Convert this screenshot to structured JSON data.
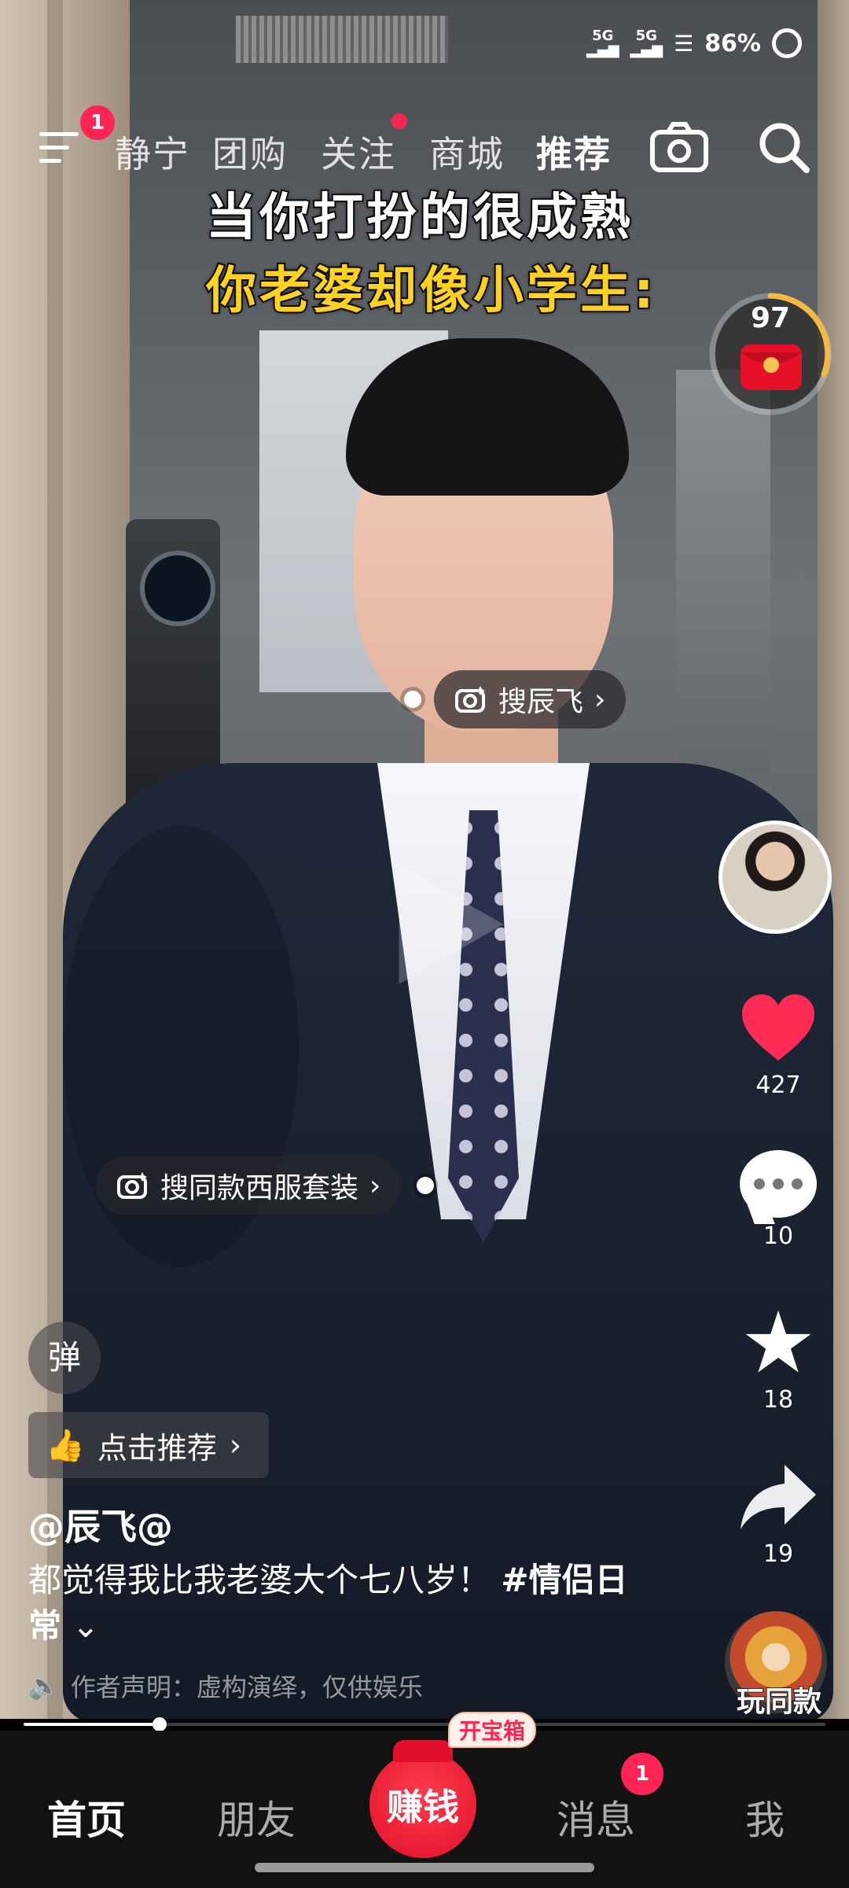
{
  "status_bar": {
    "signal_1": "5G",
    "signal_2": "5G",
    "battery": "86%"
  },
  "top_nav": {
    "menu_badge": "1",
    "tabs": [
      {
        "label": "静宁"
      },
      {
        "label": "团购"
      },
      {
        "label": "关注"
      },
      {
        "label": "商城"
      },
      {
        "label": "推荐"
      }
    ]
  },
  "caption": {
    "line1": "当你打扮的很成熟",
    "line2": "你老婆却像小学生:"
  },
  "red_packet": {
    "countdown": "97"
  },
  "search_tags": {
    "person": "搜辰飞",
    "outfit": "搜同款西服套装"
  },
  "rail": {
    "likes": "427",
    "comments": "10",
    "favorites": "18",
    "shares": "19",
    "music_label": "玩同款"
  },
  "info": {
    "danmu": "弹",
    "recommend": "点击推荐",
    "author": "@辰飞@",
    "description": "都觉得我比我老婆大个七八岁！",
    "hashtag": "#情侣日常",
    "expand": "⌄",
    "disclaimer": "作者声明：虚构演绎，仅供娱乐"
  },
  "progress": {
    "fraction": 0.17
  },
  "tab_bar": {
    "home": "首页",
    "friends": "朋友",
    "earn": "赚钱",
    "treasure": "开宝箱",
    "messages": "消息",
    "messages_badge": "1",
    "me": "我"
  },
  "colors": {
    "accent": "#ff2453",
    "caption_yellow": "#ffd21f",
    "tab_bar": "#121212"
  }
}
